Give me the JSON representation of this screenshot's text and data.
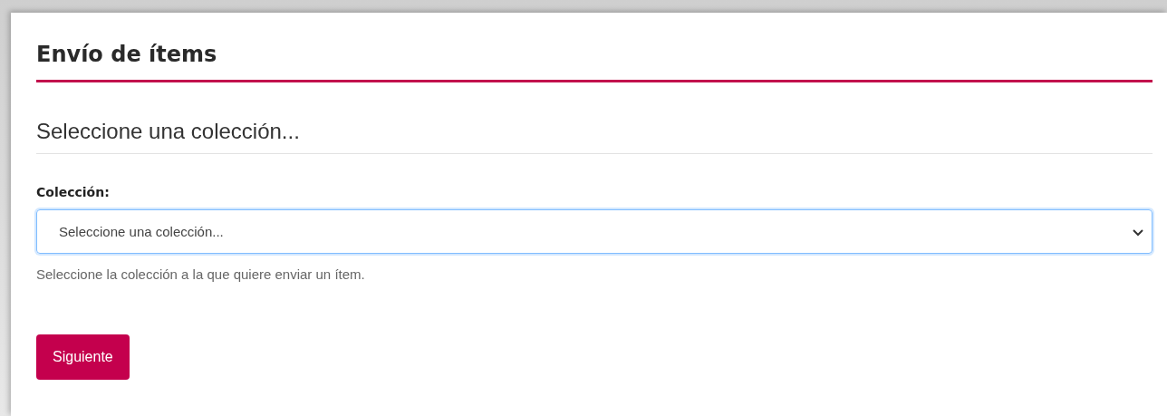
{
  "page_title": "Envío de ítems",
  "section_title": "Seleccione una colección...",
  "field": {
    "label": "Colección:",
    "value": "Seleccione una colección...",
    "focused": true,
    "help": "Seleccione la colección a la que quiere enviar un ítem."
  },
  "buttons": [
    {
      "label": "Siguiente"
    }
  ]
}
